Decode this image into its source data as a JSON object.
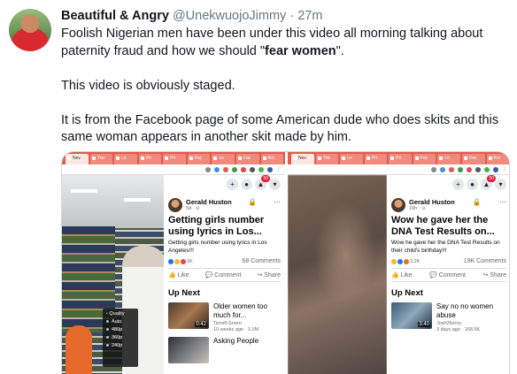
{
  "tweet": {
    "display_name": "Beautiful & Angry",
    "handle": "@UnekwuojoJimmy",
    "separator": "·",
    "time": "27m",
    "line1_pre": "Foolish Nigerian men have been under this video all morning talking about paternity fraud and how we should \"",
    "line1_bold": "fear women",
    "line1_post": "\".",
    "paragraph2": "This video is obviously staged.",
    "paragraph3": "It is from the Facebook page of some American dude who does skits and this same woman appears in another skit made by him."
  },
  "colors": {
    "browser_tab_bar": "#e05d4b",
    "facebook_badge": "#e41e3f",
    "twitter_text": "#14171a",
    "twitter_muted": "#657786"
  },
  "left_panel": {
    "tabs": [
      "Nev",
      "The",
      "Le",
      "Pri",
      "Pri",
      "Fac",
      "Le",
      "Fac",
      "Kni"
    ],
    "notification_count": "50",
    "poster_name": "Gerald Huston",
    "poster_meta": "5d · ⊙",
    "post_title": "Getting girls number using lyrics in Los...",
    "post_desc": "Getting girls number using lyrics in Los Angeles!!!",
    "reaction_count": "1K",
    "comment_count": "68 Comments",
    "actions": [
      "Like",
      "Comment",
      "Share"
    ],
    "up_next_label": "Up Next",
    "quality_menu": {
      "title": "Quality",
      "options": [
        "Auto",
        "480p",
        "360p",
        "240p"
      ]
    },
    "videos": [
      {
        "title": "Older women too much for...",
        "channel": "Terrell Green",
        "meta": "10 weeks ago · 1.1M",
        "duration": "0:42"
      },
      {
        "title": "Asking People",
        "channel": "",
        "meta": "",
        "duration": ""
      }
    ]
  },
  "right_panel": {
    "tabs": [
      "Nev",
      "The",
      "Le",
      "Pri",
      "Pri",
      "Fac",
      "Le",
      "Fac",
      "Kni"
    ],
    "notification_count": "50",
    "poster_name": "Gerald Huston",
    "poster_meta": "19h · ⊙",
    "post_title": "Wow he gave her the DNA Test Results on...",
    "post_desc": "Wow he gave her the DNA Test Results on their child's birthday!!!",
    "reaction_count": "3.2K",
    "comment_count": "19K Comments",
    "actions": [
      "Like",
      "Comment",
      "Share"
    ],
    "up_next_label": "Up Next",
    "videos": [
      {
        "title": "Say no no women abuse",
        "channel": "Josh2funny",
        "meta": "3 days ago · 168.5K",
        "duration": "3:40"
      }
    ]
  },
  "icons": [
    "plus-icon",
    "messenger-icon",
    "bell-icon",
    "caret-down-icon",
    "more-dots-icon",
    "lock-icon",
    "like-icon",
    "comment-icon",
    "share-icon"
  ]
}
